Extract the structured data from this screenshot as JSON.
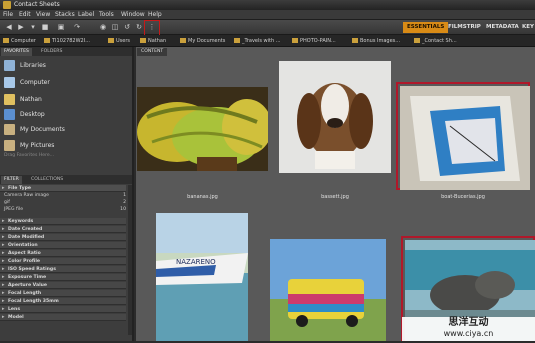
{
  "window": {
    "title": "Contact Sheets"
  },
  "menu": [
    "File",
    "Edit",
    "View",
    "Stacks",
    "Label",
    "Tools",
    "Window",
    "Help"
  ],
  "workspaces": [
    "ESSENTIALS",
    "FILMSTRIP",
    "METADATA",
    "KEY"
  ],
  "path": [
    "Computer",
    "TI102782W2I...",
    "Users",
    "Nathan",
    "My Documents",
    "_Travels with ...",
    "PHOTO-PAIN...",
    "Bonus Images...",
    "_Contact Sh..."
  ],
  "panels": {
    "favorites_tab": "FAVORITES",
    "folders_tab": "FOLDERS",
    "filter_tab": "FILTER",
    "collections_tab": "COLLECTIONS",
    "content_tab": "CONTENT"
  },
  "favorites": [
    {
      "label": "Libraries",
      "icon": "libraries-icon",
      "color": "#8fb2d6"
    },
    {
      "label": "Computer",
      "icon": "computer-icon",
      "color": "#a8c8e8"
    },
    {
      "label": "Nathan",
      "icon": "user-folder-icon",
      "color": "#e0c060"
    },
    {
      "label": "Desktop",
      "icon": "desktop-icon",
      "color": "#5b8fd0"
    },
    {
      "label": "My Documents",
      "icon": "documents-icon",
      "color": "#c8b080"
    },
    {
      "label": "My Pictures",
      "icon": "pictures-icon",
      "color": "#c8b080"
    }
  ],
  "favorites_hint": "Drag Favorites Here...",
  "filter": {
    "file_type_header": "File Type",
    "file_types": [
      {
        "label": "Camera Raw image",
        "count": "1"
      },
      {
        "label": "gif",
        "count": "2"
      },
      {
        "label": "JPEG file",
        "count": "10"
      }
    ],
    "sections": [
      "Keywords",
      "Date Created",
      "Date Modified",
      "Orientation",
      "Aspect Ratio",
      "Color Profile",
      "ISO Speed Ratings",
      "Exposure Time",
      "Aperture Value",
      "Focal Length",
      "Focal Length 35mm",
      "Lens",
      "Model"
    ]
  },
  "thumbnails": [
    {
      "caption": "bananas.jpg",
      "selected": false
    },
    {
      "caption": "bassett.jpg",
      "selected": false
    },
    {
      "caption": "boat-Bucerias.jpg",
      "selected": true
    },
    {
      "caption": "",
      "selected": false
    },
    {
      "caption": "",
      "selected": false
    },
    {
      "caption": "",
      "selected": true
    }
  ],
  "boat_name": "NAZARENO",
  "watermark": {
    "line1": "思洋互动",
    "line2": "www.ciya.cn"
  }
}
